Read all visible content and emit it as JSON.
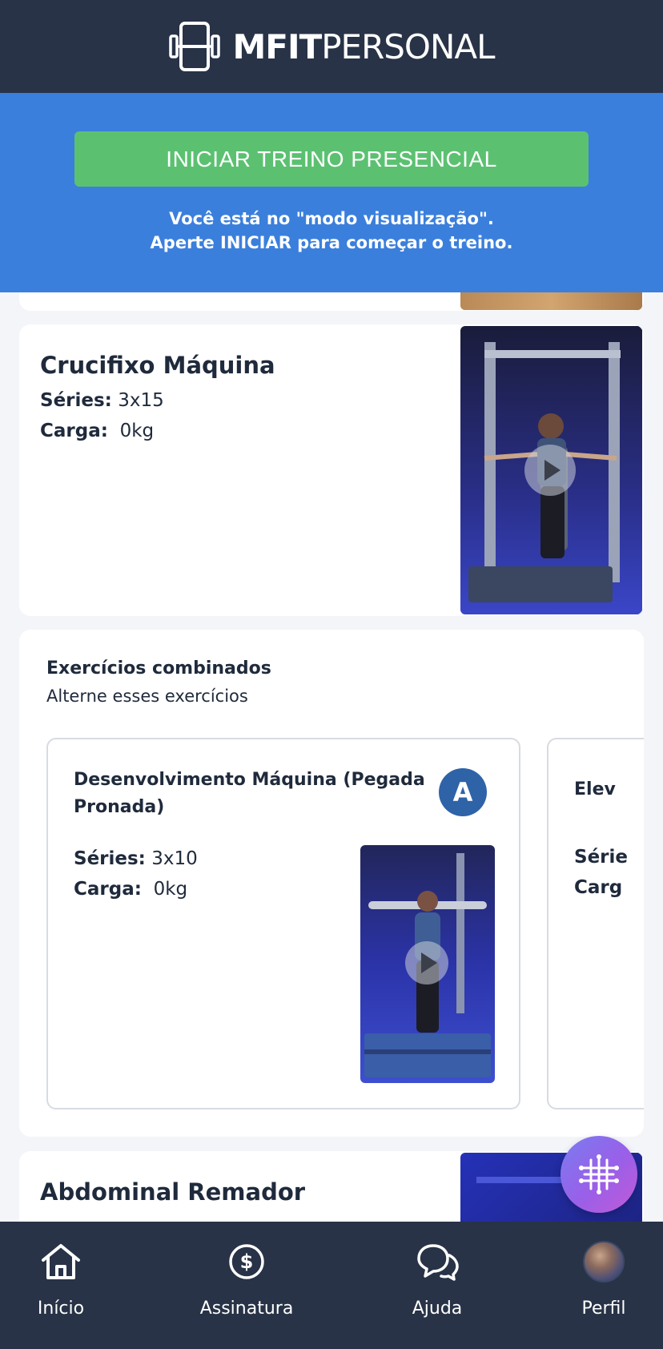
{
  "header": {
    "logo_bold": "MFIT",
    "logo_light": "PERSONAL"
  },
  "start_panel": {
    "button_label": "INICIAR TREINO PRESENCIAL",
    "message_line1": "Você está no \"modo visualização\".",
    "message_line2": "Aperte INICIAR para começar o treino."
  },
  "exercises": {
    "crucifixo": {
      "name": "Crucifixo Máquina",
      "series_label": "Séries:",
      "series_value": "3x15",
      "load_label": "Carga:",
      "load_value": "0kg"
    },
    "combined": {
      "title": "Exercícios combinados",
      "subtitle": "Alterne esses exercícios",
      "items": [
        {
          "name_line1": "Desenvolvimento Máquina (Pegada",
          "name_line2": "Pronada)",
          "badge": "A",
          "series_label": "Séries:",
          "series_value": "3x10",
          "load_label": "Carga:",
          "load_value": "0kg"
        },
        {
          "name_partial": "Elev",
          "series_partial": "Série",
          "load_partial": "Carg"
        }
      ]
    },
    "abdominal": {
      "name": "Abdominal Remador"
    }
  },
  "bottom_nav": {
    "items": [
      {
        "label": "Início",
        "icon": "home-icon"
      },
      {
        "label": "Assinatura",
        "icon": "dollar-circle-icon"
      },
      {
        "label": "Ajuda",
        "icon": "chat-bubbles-icon"
      },
      {
        "label": "Perfil",
        "icon": "avatar"
      }
    ]
  },
  "colors": {
    "header_bg": "#283347",
    "banner_bg": "#3b7fdc",
    "start_button": "#5bc171",
    "badge": "#2f63a8"
  }
}
